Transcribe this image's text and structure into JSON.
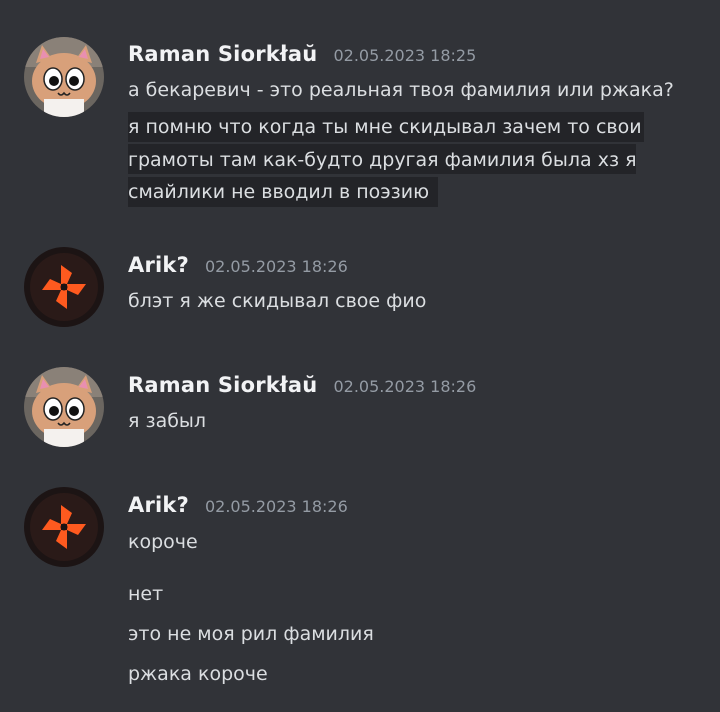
{
  "messages": [
    {
      "username": "Raman Siorkłaŭ",
      "timestamp": "02.05.2023 18:25",
      "avatar": "cat-face-avatar",
      "lines": [
        "а бекаревич - это реальная твоя фамилия или ржака?",
        "я помню что когда ты мне скидывал зачем то свои",
        "грамоты там как-будто другая фамилия была хз я",
        "смайлики не вводил в поэзию"
      ]
    },
    {
      "username": "Arik?",
      "timestamp": "02.05.2023 18:26",
      "avatar": "orange-pinwheel-avatar",
      "lines": [
        "блэт я же скидывал свое фио"
      ]
    },
    {
      "username": "Raman Siorkłaŭ",
      "timestamp": "02.05.2023 18:26",
      "avatar": "cat-face-avatar",
      "lines": [
        "я забыл"
      ]
    },
    {
      "username": "Arik?",
      "timestamp": "02.05.2023 18:26",
      "avatar": "orange-pinwheel-avatar",
      "lines": [
        "короче",
        "нет",
        "это не моя рил фамилия",
        "ржака короче"
      ]
    }
  ],
  "colors": {
    "background": "#313338",
    "username": "#f2f3f5",
    "timestamp": "#949ba4",
    "text": "#dbdee1",
    "highlight": "#232428",
    "pinwheel": "#ff5a1f"
  }
}
